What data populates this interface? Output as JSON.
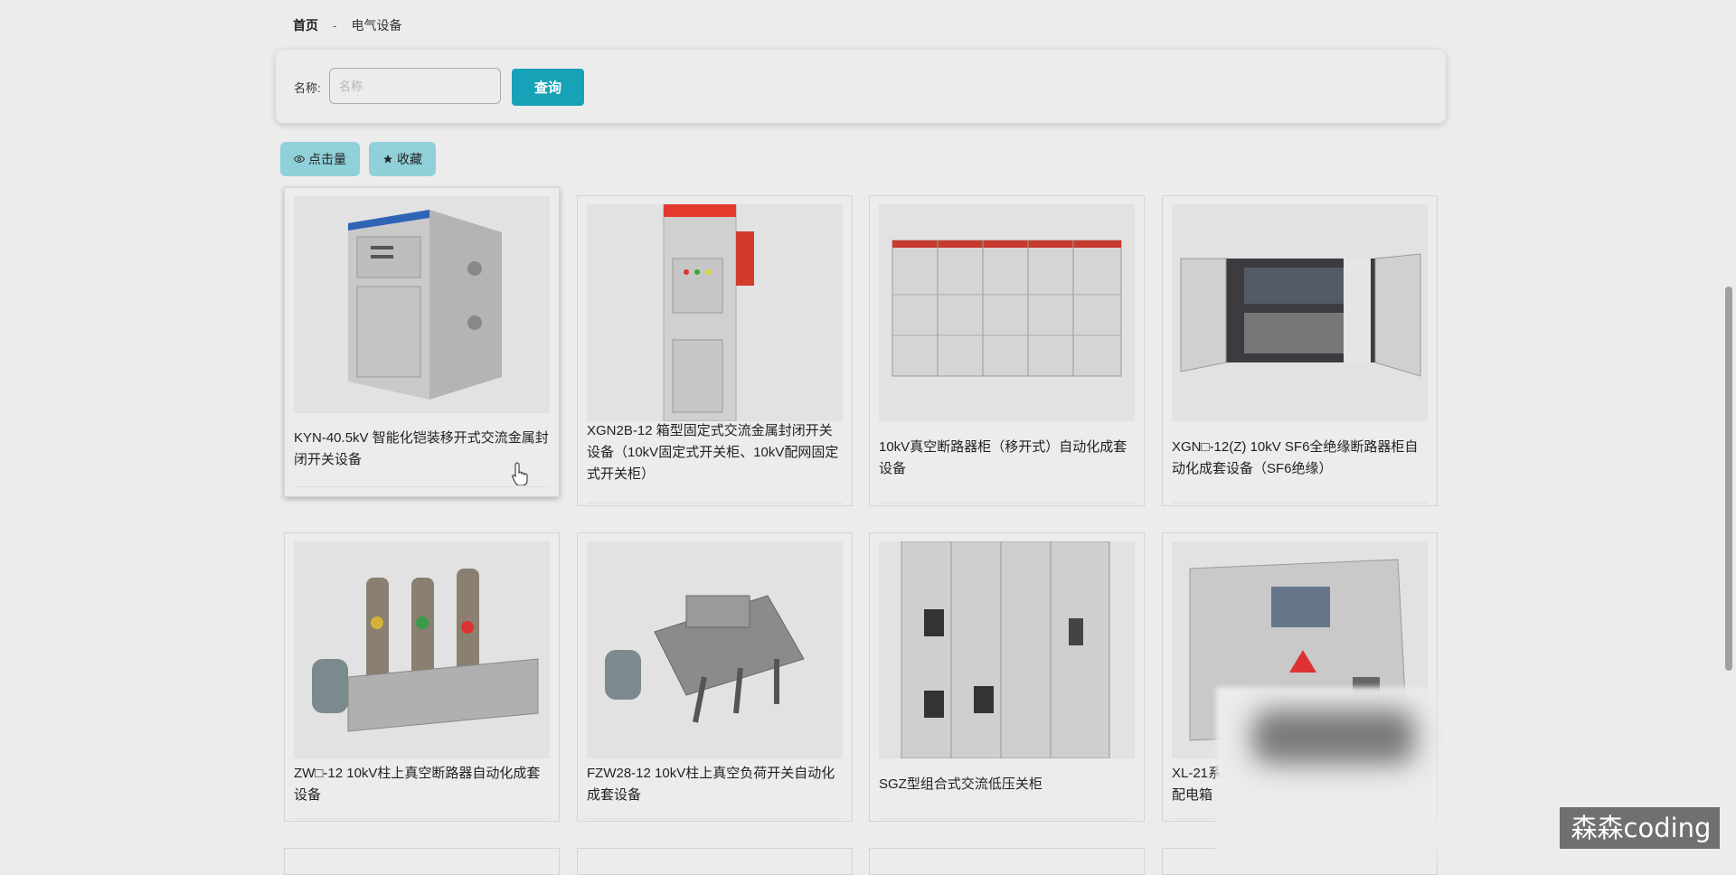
{
  "breadcrumb": {
    "home": "首页",
    "separator": "-",
    "current": "电气设备"
  },
  "search": {
    "label": "名称:",
    "placeholder": "名称",
    "value": "",
    "button_label": "查询"
  },
  "sort_buttons": [
    {
      "icon": "eye-icon",
      "label": "点击量"
    },
    {
      "icon": "star-icon",
      "label": "收藏"
    }
  ],
  "colors": {
    "accent": "#17a2b8",
    "sort_button_bg": "#8fd0d9",
    "page_bg": "#ececec"
  },
  "products": [
    {
      "title": "KYN-40.5kV 智能化铠装移开式交流金属封闭开关设备"
    },
    {
      "title": "XGN2B-12 箱型固定式交流金属封闭开关设备（10kV固定式开关柜、10kV配网固定式开关柜）"
    },
    {
      "title": "10kV真空断路器柜（移开式）自动化成套设备"
    },
    {
      "title": "XGN□-12(Z) 10kV SF6全绝缘断路器柜自动化成套设备（SF6绝缘）"
    },
    {
      "title": "ZW□-12 10kV柱上真空断路器自动化成套设备"
    },
    {
      "title": "FZW28-12 10kV柱上真空负荷开关自动化成套设备"
    },
    {
      "title": "SGZ型组合式交流低压关柜"
    },
    {
      "title": "XL-21系\n配电箱"
    }
  ],
  "watermark": "森森coding"
}
